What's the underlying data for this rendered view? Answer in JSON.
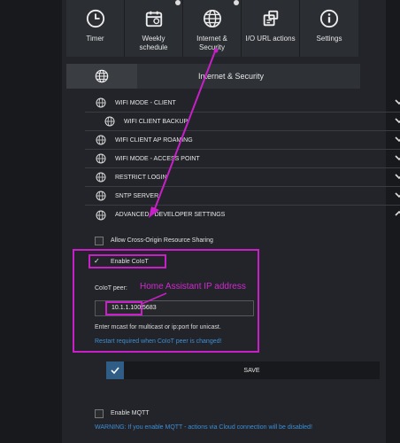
{
  "tiles": [
    {
      "label": "Timer",
      "icon": "clock-icon"
    },
    {
      "label": "Weekly\nschedule",
      "icon": "calendar-icon"
    },
    {
      "label": "Internet &\nSecurity",
      "icon": "globe-icon"
    },
    {
      "label": "I/O URL actions",
      "icon": "url-actions-icon"
    },
    {
      "label": "Settings",
      "icon": "info-icon"
    }
  ],
  "section": {
    "title": "Internet & Security",
    "icon": "globe-icon"
  },
  "rows": [
    {
      "label": "WIFI MODE - CLIENT",
      "state": "collapsed"
    },
    {
      "label": "WIFI CLIENT BACKUP",
      "state": "collapsed"
    },
    {
      "label": "WIFI CLIENT AP ROAMING",
      "state": "collapsed"
    },
    {
      "label": "WIFI MODE - ACCESS POINT",
      "state": "collapsed"
    },
    {
      "label": "RESTRICT LOGIN",
      "state": "collapsed"
    },
    {
      "label": "SNTP SERVER",
      "state": "collapsed"
    },
    {
      "label": "ADVANCED - DEVELOPER SETTINGS",
      "state": "expanded"
    }
  ],
  "advanced": {
    "cors_label": "Allow Cross-Origin Resource Sharing",
    "coiot_label": "Enable CoIoT",
    "coiot_peer_label": "CoIoT peer:",
    "coiot_peer_value": "10.1.1.100:5683",
    "hint": "Enter mcast for multicast or ip:port for unicast.",
    "restart_warning": "Restart required when CoIoT peer is changed!",
    "save_label": "SAVE",
    "mqtt_label": "Enable MQTT",
    "mqtt_warning": "WARNING: If you enable MQTT - actions via Cloud connection will be disabled!"
  },
  "annotation": {
    "label": "Home Assistant IP address",
    "color": "#c81fc8"
  }
}
